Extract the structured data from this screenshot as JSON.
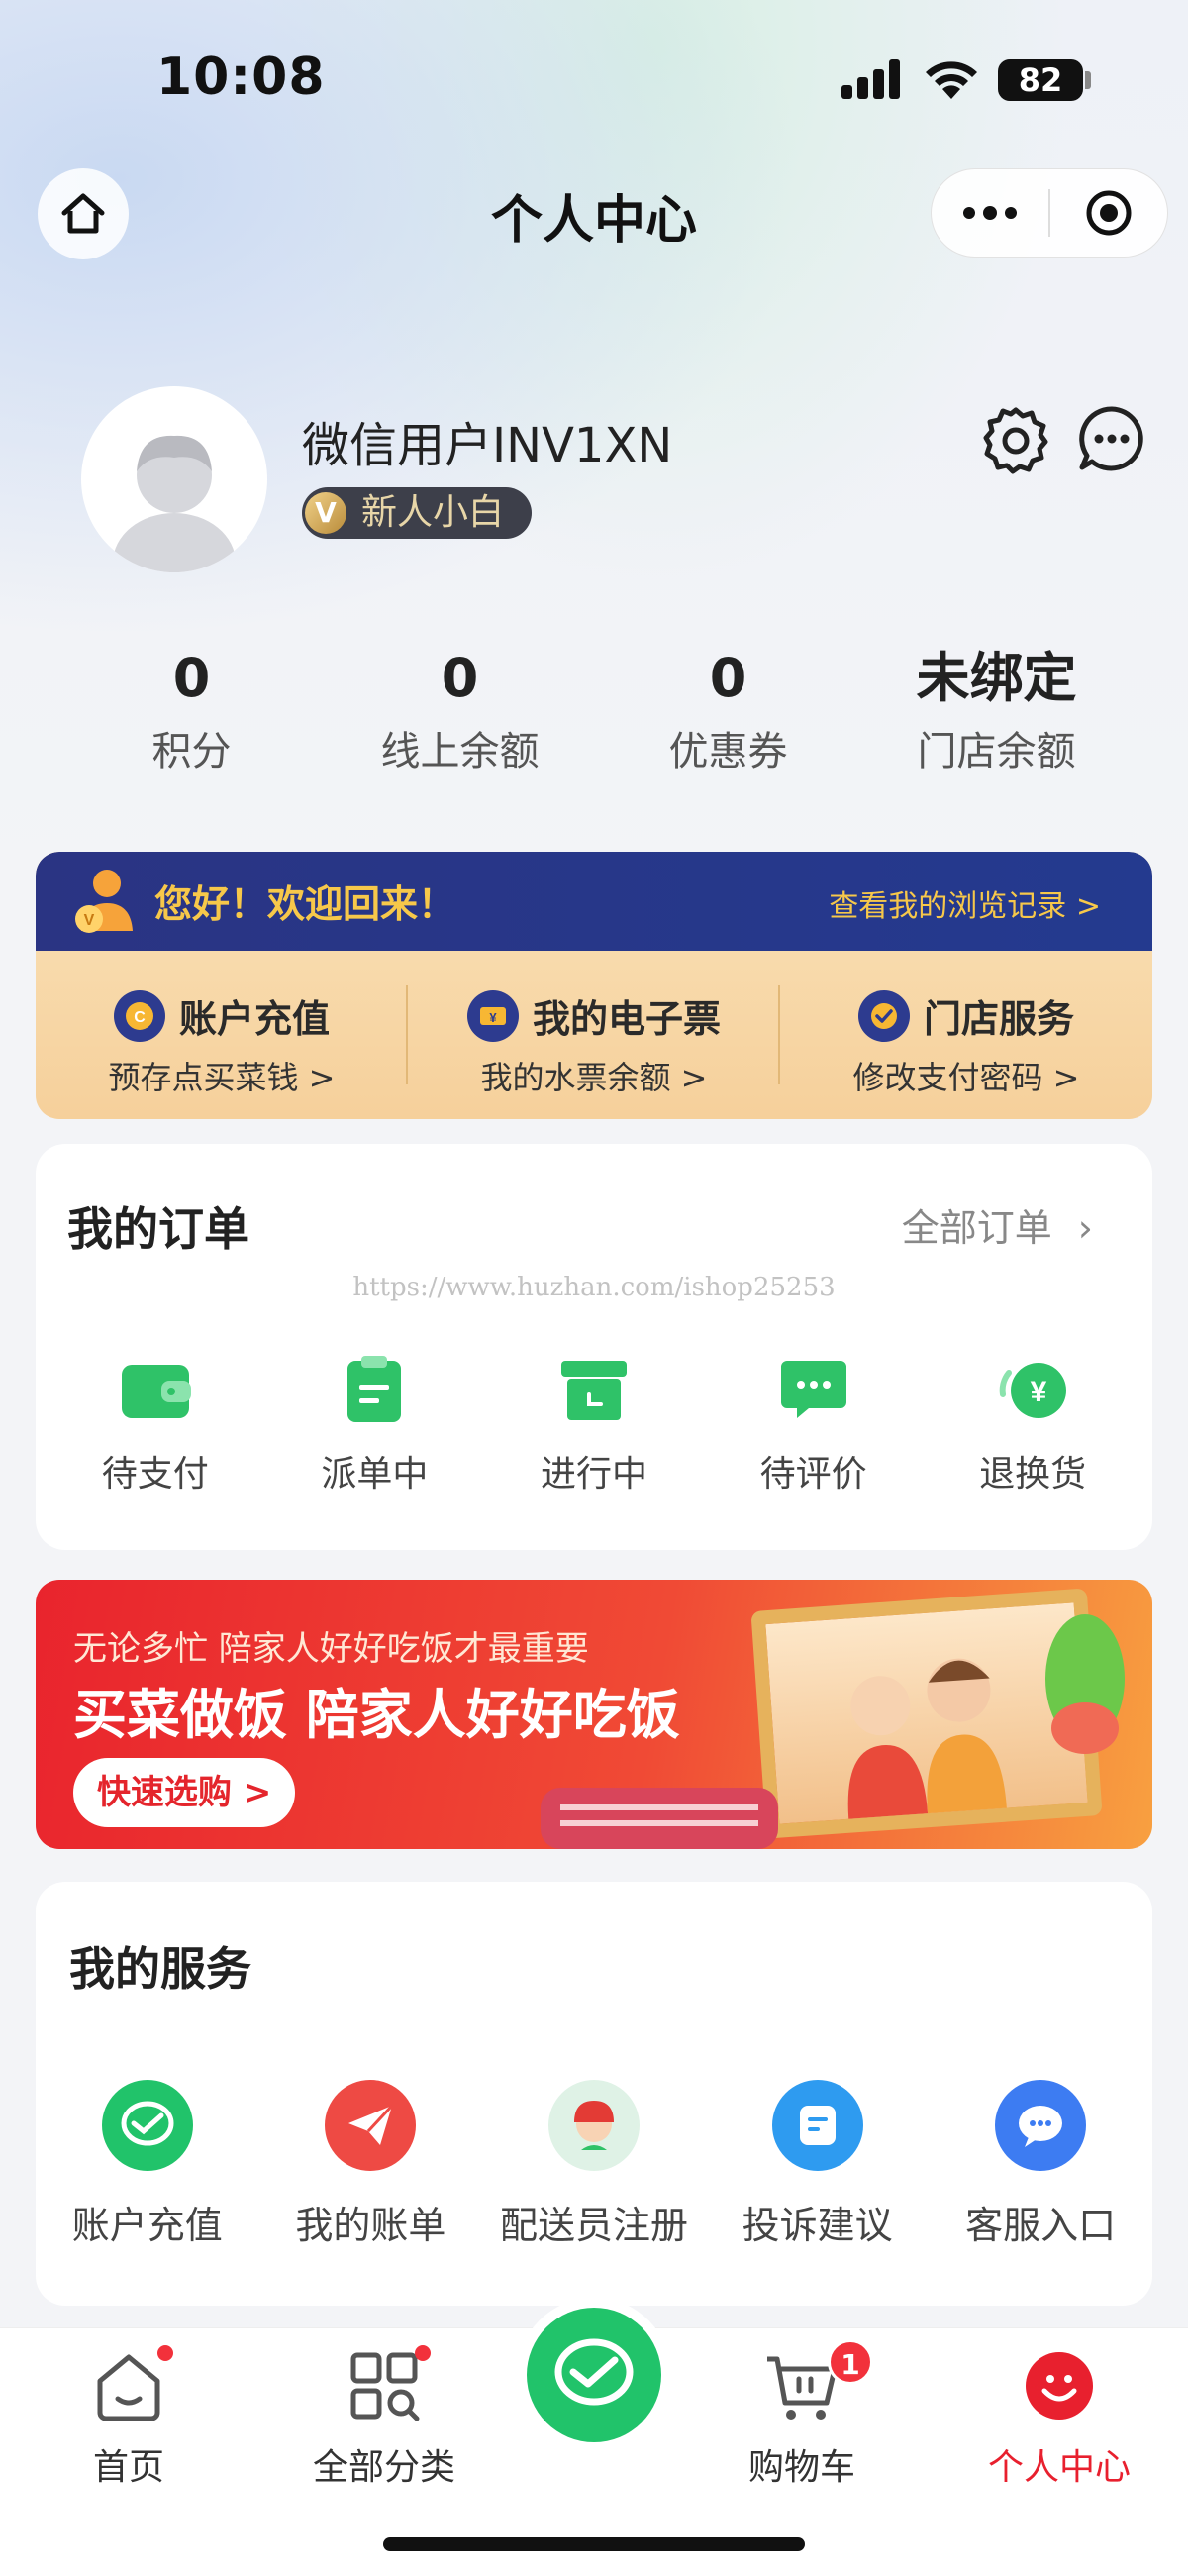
{
  "status_bar": {
    "time": "10:08",
    "battery": "82"
  },
  "nav": {
    "title": "个人中心"
  },
  "profile": {
    "username": "微信用户INV1XN",
    "level": "新人小白",
    "level_mark": "V"
  },
  "stats": [
    {
      "value": "0",
      "label": "积分"
    },
    {
      "value": "0",
      "label": "线上余额"
    },
    {
      "value": "0",
      "label": "优惠券"
    },
    {
      "value": "未绑定",
      "label": "门店余额"
    }
  ],
  "welcome": {
    "title": "您好！欢迎回来！",
    "link": "查看我的浏览记录 >",
    "columns": [
      {
        "title": "账户充值",
        "sub": "预存点买菜钱 >",
        "icon": "coin-icon"
      },
      {
        "title": "我的电子票",
        "sub": "我的水票余额 >",
        "icon": "ticket-icon"
      },
      {
        "title": "门店服务",
        "sub": "修改支付密码 >",
        "icon": "store-service-icon"
      }
    ]
  },
  "orders": {
    "title": "我的订单",
    "all_link": "全部订单",
    "watermark": "https://www.huzhan.com/ishop25253",
    "items": [
      {
        "label": "待支付",
        "icon": "wallet-icon"
      },
      {
        "label": "派单中",
        "icon": "clipboard-icon"
      },
      {
        "label": "进行中",
        "icon": "box-icon"
      },
      {
        "label": "待评价",
        "icon": "comment-icon"
      },
      {
        "label": "退换货",
        "icon": "yen-refund-icon"
      }
    ]
  },
  "banner": {
    "subtitle": "无论多忙 陪家人好好吃饭才最重要",
    "headline": "买菜做饭 陪家人好好吃饭",
    "button": "快速选购 >"
  },
  "services": {
    "title": "我的服务",
    "items": [
      {
        "label": "账户充值",
        "icon": "wechat-pay-icon",
        "color": "#21c36a"
      },
      {
        "label": "我的账单",
        "icon": "send-icon",
        "color": "#ee4a44"
      },
      {
        "label": "配送员注册",
        "icon": "courier-avatar-icon",
        "color": "#dff2e6"
      },
      {
        "label": "投诉建议",
        "icon": "feedback-icon",
        "color": "#2e9bf0"
      },
      {
        "label": "客服入口",
        "icon": "chat-icon",
        "color": "#3d7cf2"
      }
    ]
  },
  "tabbar": {
    "items": [
      {
        "label": "首页",
        "icon": "home-tab-icon"
      },
      {
        "label": "全部分类",
        "icon": "category-tab-icon"
      },
      {
        "label": "购物车",
        "icon": "cart-tab-icon"
      },
      {
        "label": "个人中心",
        "icon": "profile-tab-icon"
      }
    ],
    "cart_count": "1",
    "accent": "#e8202e"
  }
}
